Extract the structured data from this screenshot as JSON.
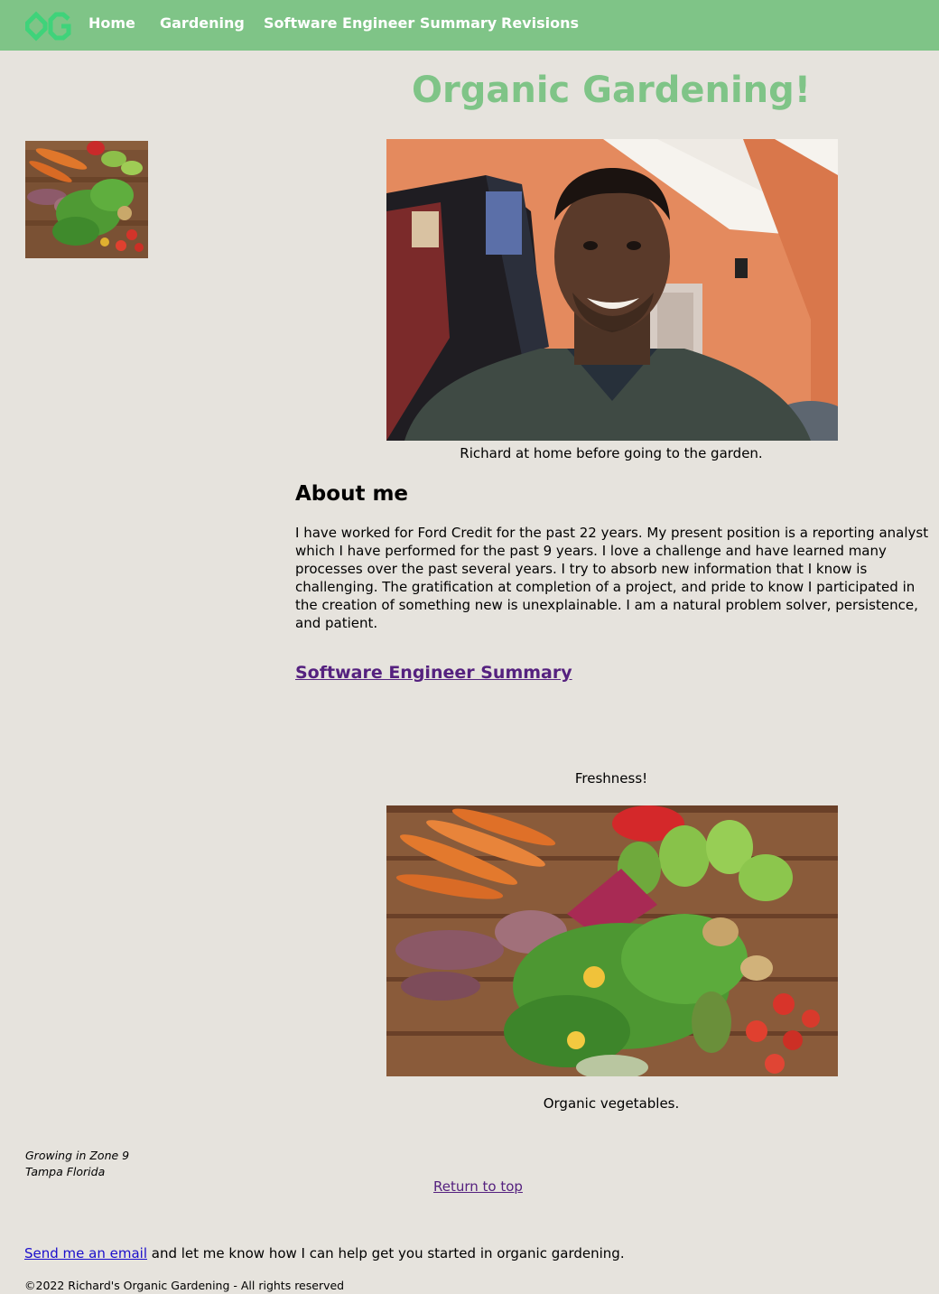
{
  "header": {
    "logo_text": "OG",
    "nav": [
      {
        "label": "Home"
      },
      {
        "label": "Gardening"
      },
      {
        "label": "Software Engineer Summary"
      },
      {
        "label": "Revisions"
      }
    ],
    "background_color": "#7fc487",
    "logo_color": "#3fd37a"
  },
  "page": {
    "title": "Organic Gardening!",
    "title_color": "#7fc487",
    "background_color": "#e6e3dd"
  },
  "portrait": {
    "caption": "Richard at home before going to the garden."
  },
  "about": {
    "heading": "About me",
    "text": "I have worked for Ford Credit for the past 22 years. My present position is a reporting analyst which I have performed for the past 9 years. I love a challenge and have learned many processes over the past several years. I try to absorb new information that I know is challenging. The gratification at completion of a project, and pride to know I participated in the creation of something new is unexplainable. I am a natural problem solver, persistence, and patient."
  },
  "summary_link": "Software Engineer Summary",
  "vegetables": {
    "heading": "Freshness!",
    "caption": "Organic vegetables."
  },
  "footer": {
    "location_line1": "Growing in Zone 9",
    "location_line2": "Tampa Florida",
    "return_link": "Return to top",
    "email_link": "Send me an email",
    "email_text": " and let me know how I can help get you started in organic gardening.",
    "copyright": "©2022 Richard's Organic Gardening - All rights reserved"
  }
}
